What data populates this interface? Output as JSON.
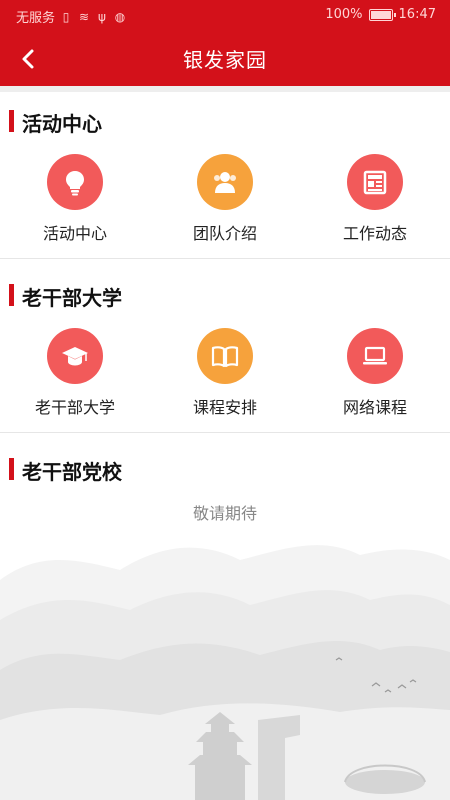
{
  "status_bar": {
    "carrier": "无服务",
    "battery_percent": "100%",
    "time": "16:47"
  },
  "header": {
    "title": "银发家园",
    "back_icon": "chevron-left-icon"
  },
  "sections": [
    {
      "title": "活动中心",
      "items": [
        {
          "label": "活动中心",
          "icon": "lightbulb-icon",
          "color": "#f25a5a"
        },
        {
          "label": "团队介绍",
          "icon": "team-icon",
          "color": "#f6a23c"
        },
        {
          "label": "工作动态",
          "icon": "news-icon",
          "color": "#f25a5a"
        }
      ]
    },
    {
      "title": "老干部大学",
      "items": [
        {
          "label": "老干部大学",
          "icon": "graduation-cap-icon",
          "color": "#f25a5a"
        },
        {
          "label": "课程安排",
          "icon": "book-icon",
          "color": "#f6a23c"
        },
        {
          "label": "网络课程",
          "icon": "laptop-icon",
          "color": "#f25a5a"
        }
      ]
    },
    {
      "title": "老干部党校"
    }
  ],
  "coming_soon": "敬请期待",
  "colors": {
    "brand_red": "#d3111a",
    "icon_red": "#f25a5a",
    "icon_orange": "#f6a23c"
  }
}
